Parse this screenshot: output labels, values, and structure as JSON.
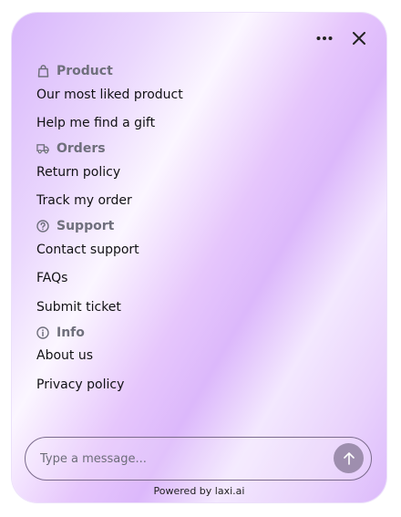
{
  "header": {
    "more_icon": "more-horizontal-icon",
    "close_icon": "close-icon"
  },
  "sections": [
    {
      "title": "Product",
      "icon": "shopping-bag-icon",
      "items": [
        "Our most liked product",
        "Help me find a gift"
      ]
    },
    {
      "title": "Orders",
      "icon": "truck-icon",
      "items": [
        "Return policy",
        "Track my order"
      ]
    },
    {
      "title": "Support",
      "icon": "help-circle-icon",
      "items": [
        "Contact support",
        "FAQs",
        "Submit ticket"
      ]
    },
    {
      "title": "Info",
      "icon": "info-icon",
      "items": [
        "About us",
        "Privacy policy"
      ]
    }
  ],
  "composer": {
    "placeholder": "Type a message...",
    "send_icon": "arrow-up-icon"
  },
  "footer": {
    "powered_by": "Powered by laxi.ai"
  },
  "colors": {
    "accent_send": "#9e8eae",
    "section_text": "#6f6f7c",
    "item_text": "#111114"
  }
}
